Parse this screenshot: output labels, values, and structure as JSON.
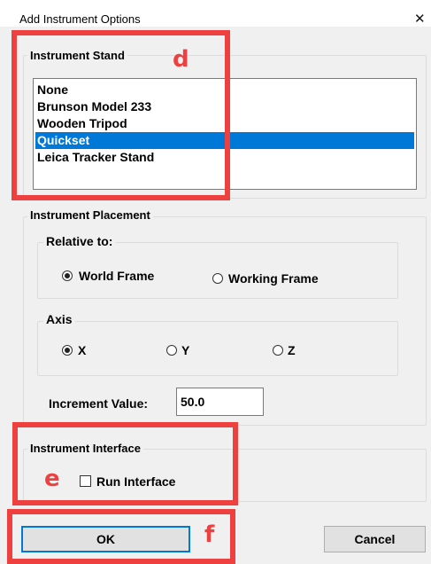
{
  "window": {
    "title": "Add Instrument Options",
    "close_glyph": "✕"
  },
  "instrument_stand": {
    "label": "Instrument Stand",
    "items": [
      "None",
      "Brunson Model 233",
      "Wooden Tripod",
      "Quickset",
      "Leica Tracker Stand"
    ],
    "selected": "Quickset"
  },
  "instrument_placement": {
    "label": "Instrument Placement",
    "relative_to": {
      "label": "Relative to:",
      "options": [
        "World Frame",
        "Working Frame"
      ],
      "selected": "World Frame"
    },
    "axis": {
      "label": "Axis",
      "options": [
        "X",
        "Y",
        "Z"
      ],
      "selected": "X"
    },
    "increment": {
      "label": "Increment Value:",
      "value": "50.0"
    }
  },
  "instrument_interface": {
    "label": "Instrument Interface",
    "run_interface_label": "Run Interface",
    "run_interface_checked": false
  },
  "buttons": {
    "ok": "OK",
    "cancel": "Cancel"
  },
  "annotations": {
    "d": "d",
    "e": "e",
    "f": "f",
    "color": "#ef4040"
  },
  "colors": {
    "selection": "#0078d7",
    "default_button_border": "#0078d7"
  }
}
